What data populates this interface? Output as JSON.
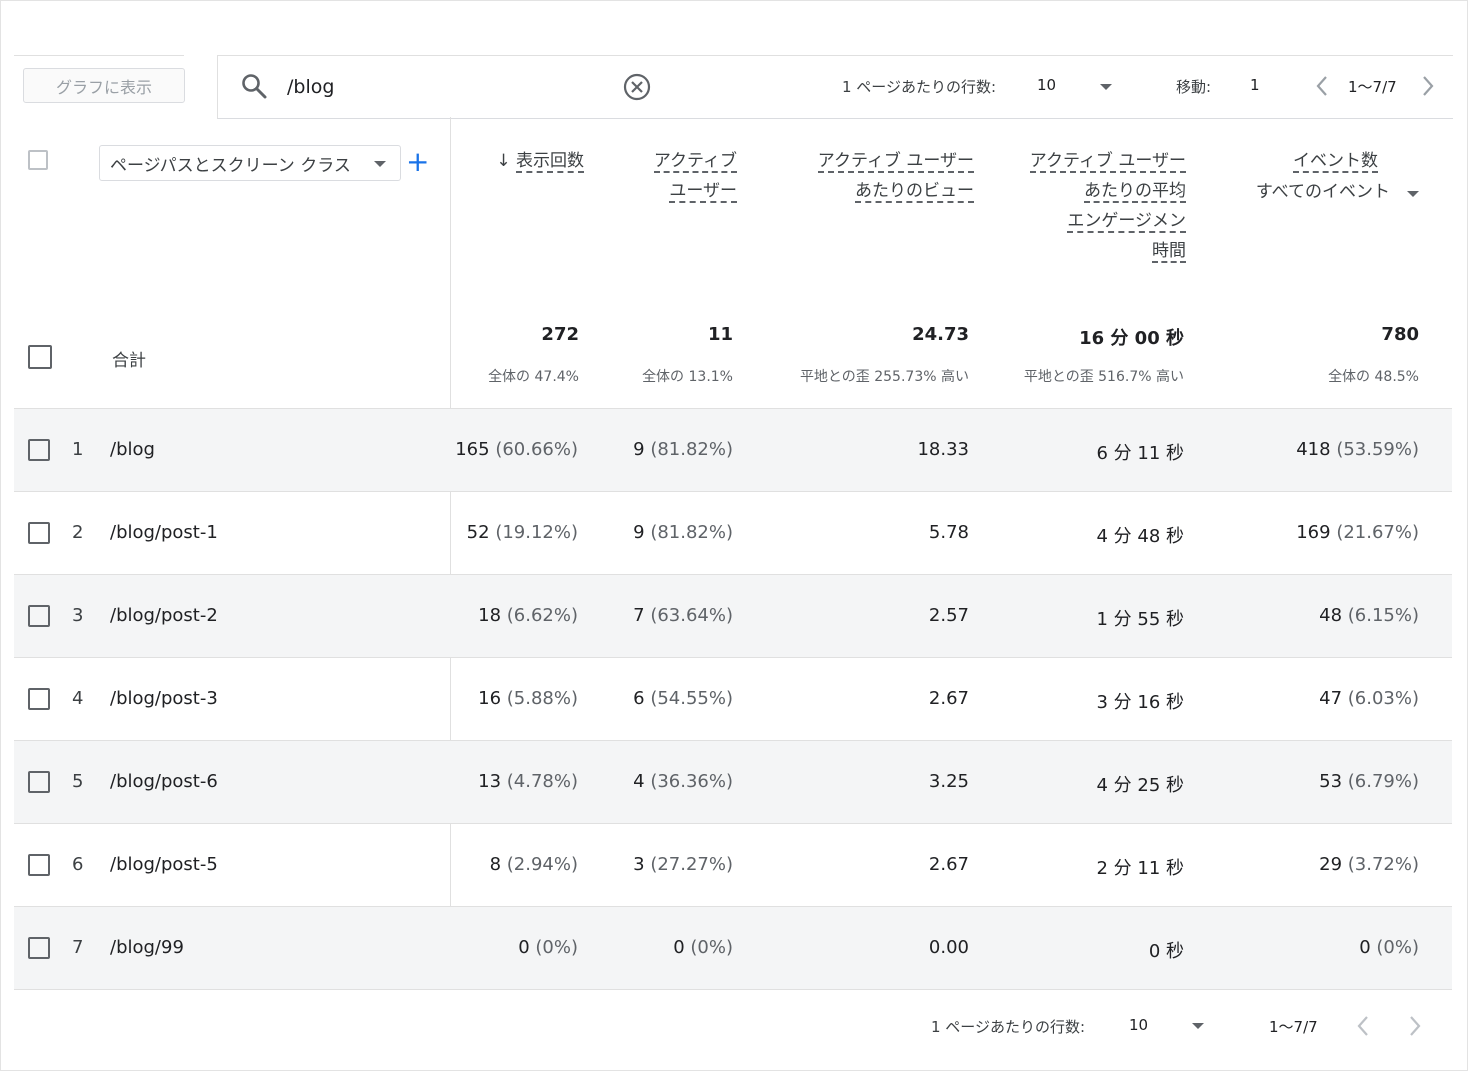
{
  "toolbar": {
    "graph_button": "グラフに表示",
    "search_value": "/blog",
    "rows_per_page_label": "1 ページあたりの行数:",
    "rows_per_page_value": "10",
    "goto_label": "移動:",
    "goto_value": "1",
    "range": "1〜7/7"
  },
  "table": {
    "dimension": "ページパスとスクリーン クラス",
    "columns": {
      "views": "表示回数",
      "active_users_1": "アクティブ",
      "active_users_2": "ユーザー",
      "views_per_user_1": "アクティブ ユーザー",
      "views_per_user_2": "あたりのビュー",
      "avg_eng_1": "アクティブ ユーザー",
      "avg_eng_2": "あたりの平均",
      "avg_eng_3": "エンゲージメン",
      "avg_eng_4": "時間",
      "events_1": "イベント数",
      "events_2": "すべてのイベント"
    },
    "totals": {
      "label": "合計",
      "views": "272",
      "views_sub": "全体の 47.4%",
      "active_users": "11",
      "active_users_sub": "全体の 13.1%",
      "views_per_user": "24.73",
      "views_per_user_sub": "平地との歪 255.73% 高い",
      "avg_eng": "16 分 00 秒",
      "avg_eng_sub": "平地との歪 516.7% 高い",
      "events": "780",
      "events_sub": "全体の 48.5%"
    },
    "rows": [
      {
        "idx": "1",
        "path": "/blog",
        "views": "165",
        "views_pct": "(60.66%)",
        "users": "9",
        "users_pct": "(81.82%)",
        "vpu": "18.33",
        "eng": "6 分 11 秒",
        "events": "418",
        "events_pct": "(53.59%)"
      },
      {
        "idx": "2",
        "path": "/blog/post-1",
        "views": "52",
        "views_pct": "(19.12%)",
        "users": "9",
        "users_pct": "(81.82%)",
        "vpu": "5.78",
        "eng": "4 分 48 秒",
        "events": "169",
        "events_pct": "(21.67%)"
      },
      {
        "idx": "3",
        "path": "/blog/post-2",
        "views": "18",
        "views_pct": "(6.62%)",
        "users": "7",
        "users_pct": "(63.64%)",
        "vpu": "2.57",
        "eng": "1 分 55 秒",
        "events": "48",
        "events_pct": "(6.15%)"
      },
      {
        "idx": "4",
        "path": "/blog/post-3",
        "views": "16",
        "views_pct": "(5.88%)",
        "users": "6",
        "users_pct": "(54.55%)",
        "vpu": "2.67",
        "eng": "3 分 16 秒",
        "events": "47",
        "events_pct": "(6.03%)"
      },
      {
        "idx": "5",
        "path": "/blog/post-6",
        "views": "13",
        "views_pct": "(4.78%)",
        "users": "4",
        "users_pct": "(36.36%)",
        "vpu": "3.25",
        "eng": "4 分 25 秒",
        "events": "53",
        "events_pct": "(6.79%)"
      },
      {
        "idx": "6",
        "path": "/blog/post-5",
        "views": "8",
        "views_pct": "(2.94%)",
        "users": "3",
        "users_pct": "(27.27%)",
        "vpu": "2.67",
        "eng": "2 分 11 秒",
        "events": "29",
        "events_pct": "(3.72%)"
      },
      {
        "idx": "7",
        "path": "/blog/99",
        "views": "0",
        "views_pct": "(0%)",
        "users": "0",
        "users_pct": "(0%)",
        "vpu": "0.00",
        "eng": "0 秒",
        "events": "0",
        "events_pct": "(0%)"
      }
    ]
  },
  "footer": {
    "rows_per_page_label": "1 ページあたりの行数:",
    "rows_per_page_value": "10",
    "range": "1〜7/7"
  },
  "colors": {
    "accent": "#1a73e8",
    "row_shade": "#f4f5f6"
  }
}
